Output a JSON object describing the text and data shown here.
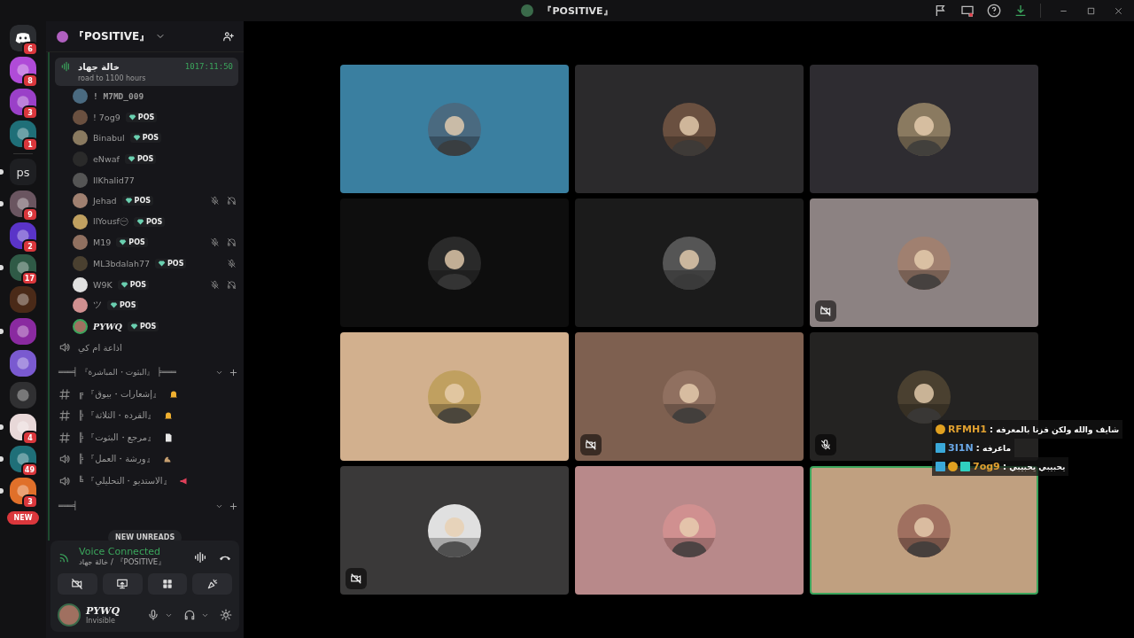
{
  "title_bar": {
    "title": "『POSITIVE』"
  },
  "server_rail": [
    {
      "kind": "home",
      "color": "#2b2d31",
      "badge": "6",
      "unread": false
    },
    {
      "kind": "server",
      "color": "#b04bd8",
      "badge": "8",
      "unread": false
    },
    {
      "kind": "server",
      "color": "#9a40c8",
      "badge": "3",
      "unread": false
    },
    {
      "kind": "server",
      "color": "#1f6f78",
      "badge": "1",
      "unread": false
    },
    {
      "kind": "divider"
    },
    {
      "kind": "text",
      "label": "ps",
      "color": "#1e1f22",
      "unread": true
    },
    {
      "kind": "server",
      "color": "#6a5560",
      "badge": "9",
      "unread": true
    },
    {
      "kind": "server",
      "color": "#5a34c8",
      "badge": "2",
      "unread": false
    },
    {
      "kind": "server",
      "color": "#2f5a46",
      "badge": "17",
      "unread": true
    },
    {
      "kind": "server",
      "color": "#4a2a18",
      "unread": false
    },
    {
      "kind": "server",
      "color": "#8a2aa0",
      "unread": true
    },
    {
      "kind": "server",
      "color": "#7a5ad0",
      "unread": false
    },
    {
      "kind": "server",
      "color": "#303032",
      "unread": false
    },
    {
      "kind": "server",
      "color": "#e8d8d8",
      "badge": "4",
      "unread": true
    },
    {
      "kind": "server",
      "color": "#1f6f78",
      "badge": "49",
      "unread": true
    },
    {
      "kind": "server",
      "color": "#e0702a",
      "badge": "3",
      "unread": true
    },
    {
      "kind": "new",
      "label": "NEW"
    }
  ],
  "server_header": {
    "name": "『POSITIVE』"
  },
  "voice_channel": {
    "name": "خالة جهاد",
    "status": "road to 1100 hours",
    "timer": "1017:11:50"
  },
  "members": [
    {
      "name": "! M7MD_009",
      "muted": false,
      "deafened": false,
      "speaking": false
    },
    {
      "name": "! 7og9",
      "tag": "POS",
      "muted": false,
      "deafened": false,
      "speaking": false
    },
    {
      "name": "Binabul",
      "tag": "POS",
      "muted": false,
      "deafened": false,
      "speaking": false
    },
    {
      "name": "eNwaf",
      "tag": "POS",
      "muted": false,
      "deafened": false,
      "speaking": false
    },
    {
      "name": "IlKhalid77",
      "muted": false,
      "deafened": false,
      "speaking": false
    },
    {
      "name": "Jehad",
      "tag": "POS",
      "muted": true,
      "deafened": true,
      "speaking": false
    },
    {
      "name": "llYousf㊀",
      "tag": "POS",
      "muted": false,
      "deafened": false,
      "speaking": false
    },
    {
      "name": "M19",
      "tag": "POS",
      "muted": true,
      "deafened": true,
      "speaking": false
    },
    {
      "name": "ML3bdalah77",
      "tag": "POS",
      "muted": true,
      "deafened": false,
      "speaking": false
    },
    {
      "name": "W9K",
      "tag": "POS",
      "muted": true,
      "deafened": true,
      "speaking": false
    },
    {
      "name": "ツ",
      "tag": "POS",
      "muted": false,
      "deafened": false,
      "speaking": false
    },
    {
      "name": "PYWQ",
      "tag": "POS",
      "muted": false,
      "deafened": false,
      "speaking": true
    }
  ],
  "channels": [
    {
      "kind": "voice",
      "name": "اذاعة ام كي"
    },
    {
      "kind": "category",
      "name": "═══╡ 『البثوت・المباشرة』 ╞═══"
    },
    {
      "kind": "text",
      "name": "╔ 『إشعارات・بيوق』"
    },
    {
      "kind": "text",
      "name": "╠ 『القرده・الثلاثة』"
    },
    {
      "kind": "text",
      "name": "╠ 『مرجع・البثوت』"
    },
    {
      "kind": "voice",
      "name": "╠ 『ورشة・العمل』"
    },
    {
      "kind": "voice",
      "name": "╚ 『الاستديو・التحليلي』"
    },
    {
      "kind": "category",
      "name": "═══╡"
    }
  ],
  "new_unreads": "NEW UNREADS",
  "voice_panel": {
    "status": "Voice Connected",
    "location": "خالة جهاد / 『POSITIVE』"
  },
  "user_panel": {
    "name": "PYWQ",
    "status": "Invisible"
  },
  "tiles": [
    {
      "color": "#3a7fa0",
      "video_off": false,
      "mic_off": false,
      "speaking": false
    },
    {
      "color": "#2b2a2c",
      "video_off": false,
      "mic_off": false,
      "speaking": false
    },
    {
      "color": "#2e2c31",
      "video_off": false,
      "mic_off": false,
      "speaking": false
    },
    {
      "color": "#0e0e0e",
      "video_off": false,
      "mic_off": false,
      "speaking": false
    },
    {
      "color": "#1b1b1b",
      "video_off": false,
      "mic_off": false,
      "speaking": false
    },
    {
      "color": "#8c8282",
      "video_off": true,
      "mic_off": false,
      "speaking": false
    },
    {
      "color": "#d2b08e",
      "video_off": false,
      "mic_off": false,
      "speaking": false
    },
    {
      "color": "#7e6050",
      "video_off": true,
      "mic_off": false,
      "speaking": false
    },
    {
      "color": "#242322",
      "video_off": false,
      "mic_off": true,
      "speaking": false
    },
    {
      "color": "#3a3939",
      "video_off": true,
      "mic_off": false,
      "speaking": false
    },
    {
      "color": "#b8898a",
      "video_off": false,
      "mic_off": false,
      "speaking": false
    },
    {
      "color": "#c0a080",
      "video_off": false,
      "mic_off": false,
      "speaking": true
    }
  ],
  "chat": [
    {
      "user": "RFMH1",
      "color": "#e0a030",
      "separator": ":",
      "message": "شايف والله ولكن فزنا بالمعرفه",
      "badges": [
        {
          "kind": "coin"
        }
      ]
    },
    {
      "user": "3I1N",
      "color": "#6aa8e8",
      "separator": ":",
      "message": "ماعرفه",
      "badges": [
        {
          "kind": "mod"
        }
      ]
    },
    {
      "user": "7og9",
      "color": "#e0a030",
      "separator": ":",
      "message": "يحبيبي يحبيبي",
      "badges": [
        {
          "kind": "mod"
        },
        {
          "kind": "coin"
        },
        {
          "kind": "sub"
        }
      ]
    }
  ]
}
